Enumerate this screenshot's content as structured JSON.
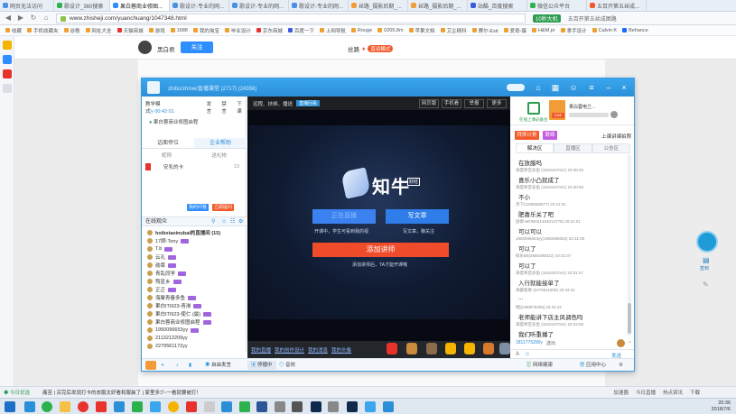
{
  "browser": {
    "tabs": [
      {
        "label": "网页无法访问",
        "active": false
      },
      {
        "label": "歌设计_360搜索",
        "active": false
      },
      {
        "label": "果白蓉商业修图...",
        "active": true
      },
      {
        "label": "歌设计-专业的网...",
        "active": false
      },
      {
        "label": "歌设计-专业的网...",
        "active": false
      },
      {
        "label": "歌设计-专业的网...",
        "active": false
      },
      {
        "label": "丝路_摄影后期_...",
        "active": false
      },
      {
        "label": "丝路_摄影后期_...",
        "active": false
      },
      {
        "label": "站酷_百度搜索",
        "active": false
      },
      {
        "label": "微信公众平台",
        "active": false
      },
      {
        "label": "五百开第五丝成...",
        "active": false
      }
    ],
    "url": "www.zhisheji.com/yuanchuang/1047348.html",
    "addr_right": [
      "10秒大机",
      "五百开第五丝成图路"
    ],
    "bookmarks": [
      "收藏",
      "手机收藏夹",
      "谷歌",
      "网址大全",
      "天猫商城",
      "游戏",
      "1688",
      "我的淘宝",
      "毕业设计",
      "京东商城",
      "百度一下",
      "上网导航",
      "Rouge",
      "0205.8m",
      "苹果文档",
      "艾企精科",
      "赛尔-Exit",
      "爱奇-爆",
      "H&M.pr",
      "拿手设计",
      "Calvin K",
      "Behance"
    ]
  },
  "site": {
    "username": "黑白君",
    "follow_label": "关注",
    "crumb_text": "丝路",
    "crumb_tag": "直运模式"
  },
  "app": {
    "title": "zhibo/zhinw/直播课堂 (2717)  (24356)",
    "left": {
      "mode_label": "教学模式",
      "mode_actions": [
        "发言",
        "禁言",
        "下课"
      ],
      "timer": "00:42:01",
      "teacher_row": "果白蓉商业修图启程",
      "tabs": [
        "话面帝位",
        "企业帮助"
      ],
      "list_header": [
        "昵称",
        "送礼物"
      ],
      "list_item": "安乳的卡",
      "list_item_count": "13",
      "btn_a": "我的问答",
      "btn_b": "立即提问",
      "viewers_title": "在线观众",
      "viewers": [
        "hoibxiaoinubai的直播间 (15)",
        "17顾-Tony",
        "T.b",
        "云孔",
        "勋章",
        "青乱同学",
        "殇显乡",
        "正正",
        "海聚青春多鱼",
        "果白ITI923-青淋",
        "果白ITI923-使仁 (最)",
        "果白蓉商业修图启程",
        "1950096653yy",
        "2113212209yy",
        "2279561172yy"
      ]
    },
    "video": {
      "top_text": "远程、扶绑、播送",
      "live_badge": "直播回看",
      "top_buttons": [
        "网页版",
        "手机看",
        "举报",
        "更多"
      ],
      "brand": "知牛",
      "brand_sub": "财经",
      "btn_left": "正在直播",
      "btn_right": "写文章",
      "cap_left": "开课中，学生可看到我的视",
      "cap_right": "写文章，赚关注",
      "btn_main": "添加讲师",
      "cap_main": "添加讲师后，TA才能开课哦",
      "gift_links": [
        "我的直播",
        "我的创作设计",
        "我的消息",
        "我的头像"
      ]
    },
    "right": {
      "check_caption": "在线上课必备台",
      "top_title": "果白蓉电兰...",
      "level_badge": "Lv4",
      "btn_a": "拜师计划",
      "btn_b": "联络",
      "right_link": "上课讲课拍照",
      "tabs": [
        "解决区",
        "直播区",
        "公告区"
      ],
      "chat": [
        {
          "type": "body",
          "text": "在放腊吗"
        },
        {
          "type": "meta",
          "text": "海盟青苗多鱼 (1815167041) 20:30:45"
        },
        {
          "type": "body",
          "text": "喜乐小凸就成了"
        },
        {
          "type": "meta",
          "text": "海盟青苗多鱼 (1815167041) 20:30:58"
        },
        {
          "type": "body",
          "text": "不小"
        },
        {
          "type": "meta",
          "text": "月下(2298568077) 20:31:01"
        },
        {
          "type": "body",
          "text": "肥喜乐关了吧"
        },
        {
          "type": "meta",
          "text": "勋章-MOMO(1484014779) 20:31:01"
        },
        {
          "type": "body",
          "text": "可以可以"
        },
        {
          "type": "meta",
          "text": "1950096653yy(1950096653) 20:31:05"
        },
        {
          "type": "body",
          "text": "可以了"
        },
        {
          "type": "meta",
          "text": "知乐B8(3685399322) 20:31:07"
        },
        {
          "type": "body",
          "text": "可以了"
        },
        {
          "type": "meta",
          "text": "海盟青苗多鱼 (1815167041) 20:31:57"
        },
        {
          "type": "body",
          "text": "入行就能接单了"
        },
        {
          "type": "meta",
          "text": "海霸者廖 (2279511808) 20:32:41"
        },
        {
          "type": "body",
          "text": "..."
        },
        {
          "type": "meta",
          "text": "明[2298878309] 20:32:42"
        },
        {
          "type": "body",
          "text": "老师能讲下店主风调色吗"
        },
        {
          "type": "meta",
          "text": "海盟青苗多鱼 (1815167041) 20:33:08"
        },
        {
          "type": "body",
          "text": "我们听重播了"
        }
      ],
      "input_user": "1811775290y",
      "input_hint": "送出",
      "send_label": "发送"
    },
    "bottom": {
      "mic_label": "自由发言",
      "stop_label": "停播中",
      "audio_label": "音效",
      "right_a": "发送",
      "net_label": "网络健康",
      "app_center": "应用中心"
    }
  },
  "widget": {
    "label": "签到"
  },
  "statusbar": {
    "left": "今日优选",
    "news": "痛苦 | 买完后发现打卡的衣服太好看和服装了 | 家里多少-一看就要被打！",
    "right": [
      "加速器",
      "今日直播",
      "热点资讯",
      "下载"
    ]
  },
  "clock": {
    "time": "20:36",
    "date": "2018/7/6"
  }
}
